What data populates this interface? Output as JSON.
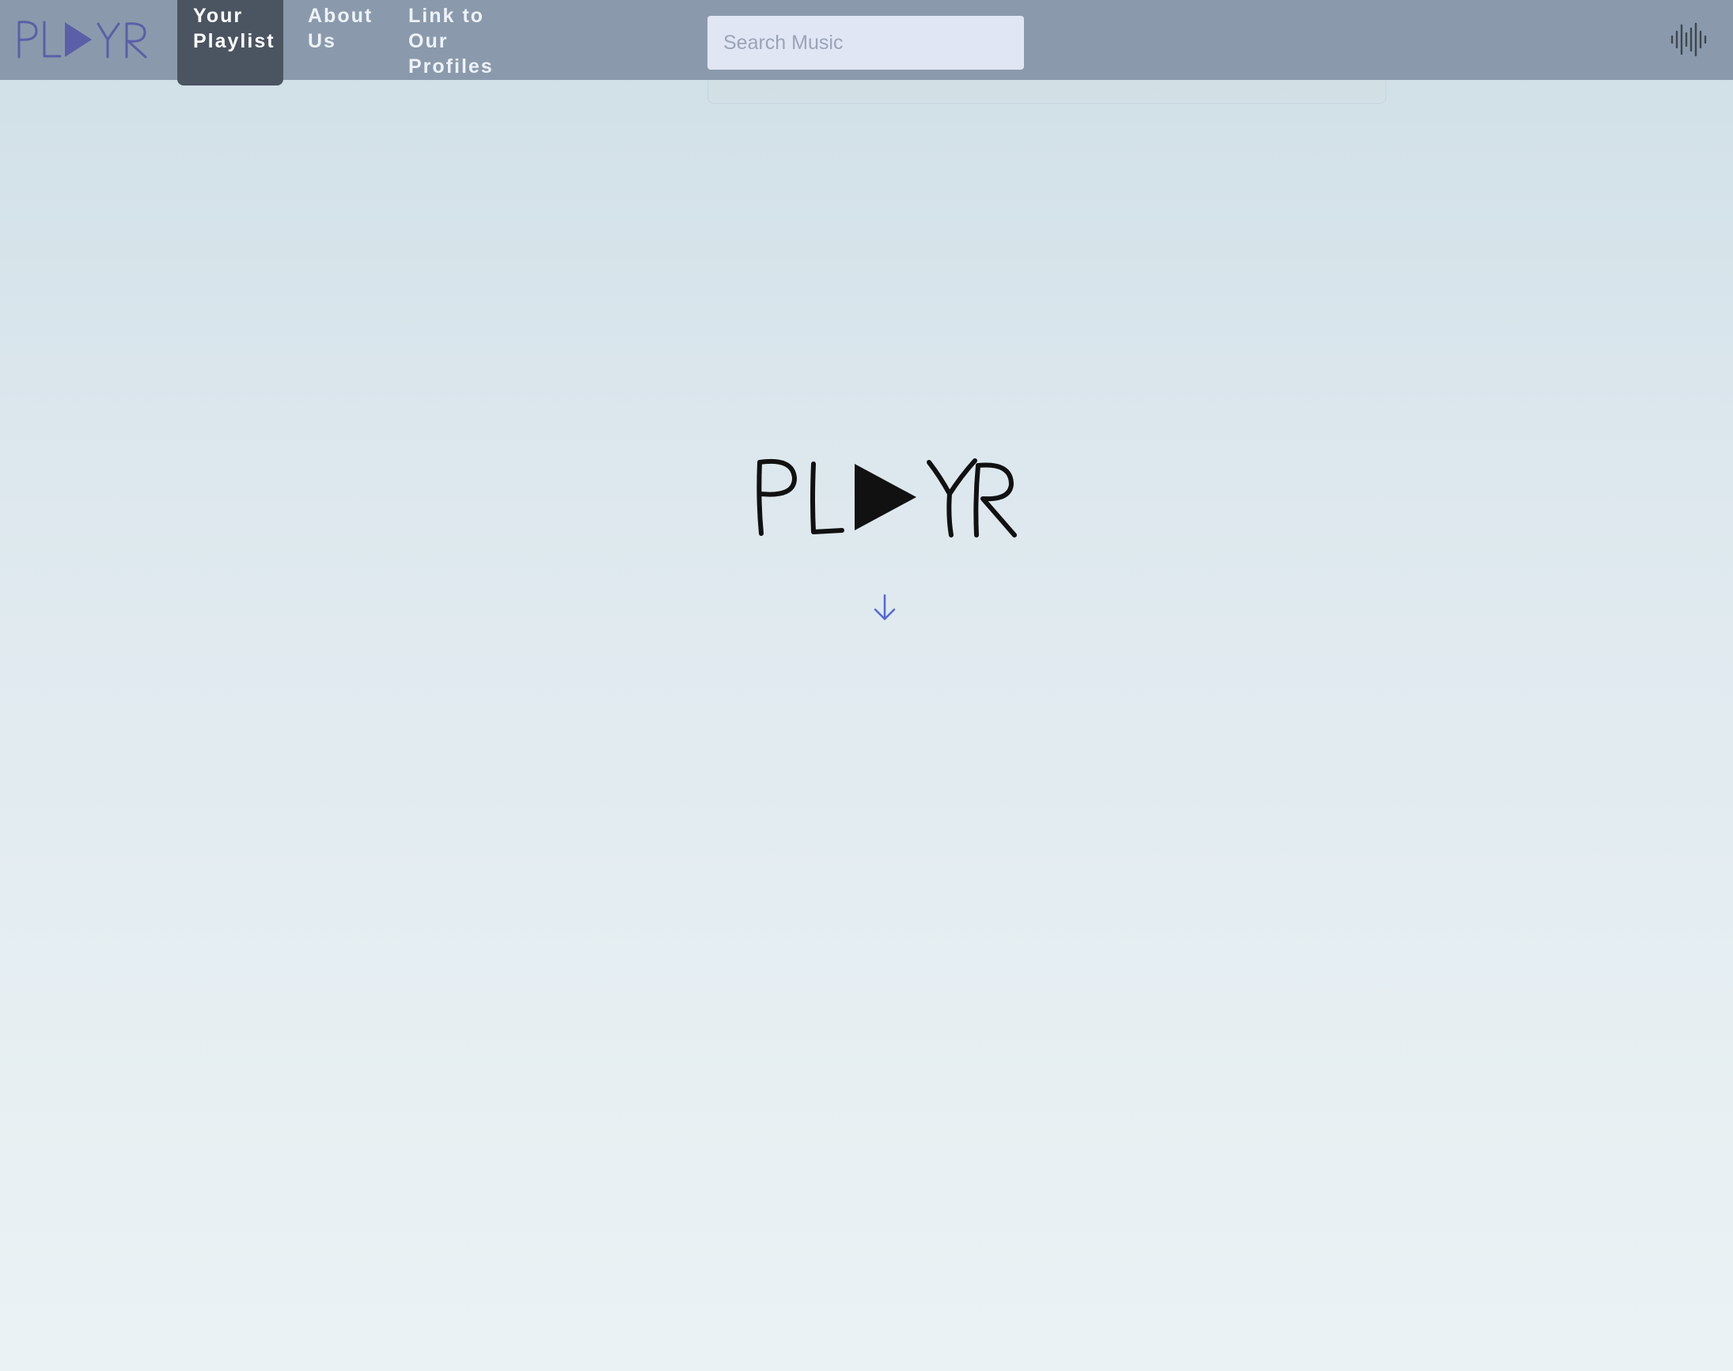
{
  "brand": {
    "name": "PLAYR",
    "logo_color": "#5b5fa8",
    "hero_logo_color": "#111111"
  },
  "nav": {
    "items": [
      {
        "label": "Your\nPlaylist",
        "active": true
      },
      {
        "label": "About\nUs",
        "active": false
      },
      {
        "label": "Link to\nOur\nProfiles",
        "active": false
      }
    ]
  },
  "search": {
    "placeholder": "Search Music",
    "value": ""
  },
  "icons": {
    "top_right": "sound-wave-icon",
    "scroll": "arrow-down-icon"
  },
  "colors": {
    "navbar": "#8a9aac",
    "active_tab": "#4b5561",
    "arrow": "#5566d6"
  }
}
